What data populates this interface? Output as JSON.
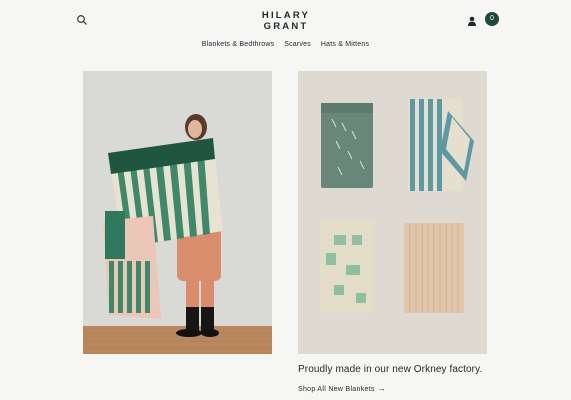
{
  "brand": {
    "line1": "HILARY",
    "line2": "GRANT"
  },
  "header": {
    "search_icon": "search-icon",
    "account_icon": "user-icon",
    "cart_count": "0"
  },
  "nav": {
    "items": [
      {
        "label": "Blankets & Bedthrows"
      },
      {
        "label": "Scarves"
      },
      {
        "label": "Hats & Mittens"
      }
    ]
  },
  "feature": {
    "tagline": "Proudly made in our new Orkney factory.",
    "link_label": "Shop All New Blankets",
    "link_arrow": "→"
  },
  "colors": {
    "accent": "#1e4a3b",
    "background": "#f6f6f4",
    "text": "#1f2a26"
  }
}
